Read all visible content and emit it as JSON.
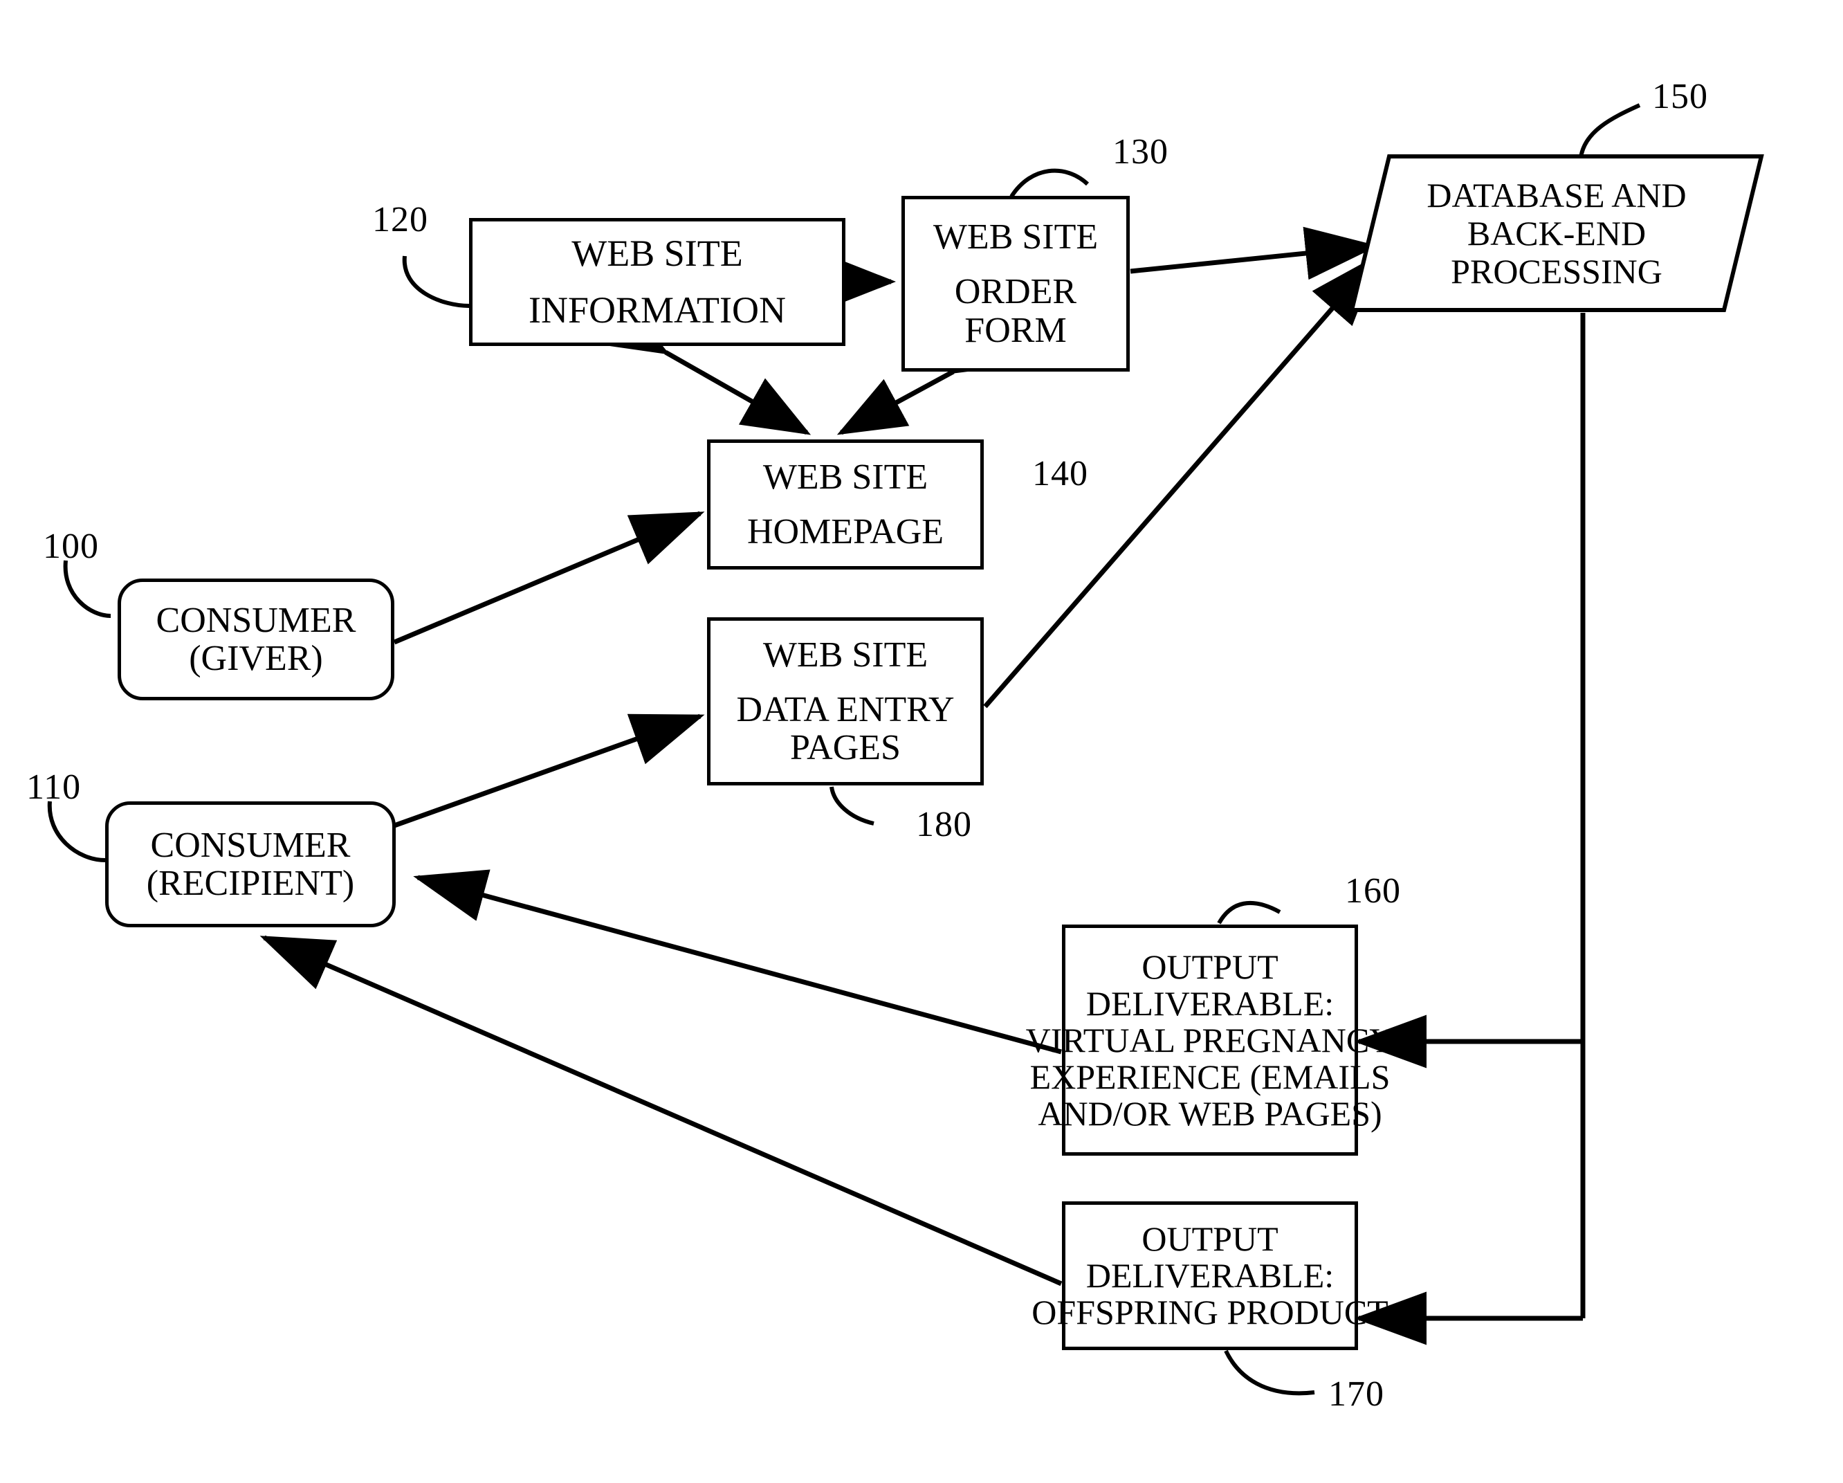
{
  "figure": {
    "type": "patent-flow-diagram",
    "background": "#ffffff",
    "stroke": "#000000"
  },
  "nodes": {
    "consumer_giver": {
      "ref": "100",
      "line1": "CONSUMER",
      "line2": "(GIVER)",
      "shape": "rounded-rectangle"
    },
    "consumer_recipient": {
      "ref": "110",
      "line1": "CONSUMER",
      "line2": "(RECIPIENT)",
      "shape": "rounded-rectangle"
    },
    "web_site_information": {
      "ref": "120",
      "line1": "WEB SITE",
      "line2": "INFORMATION",
      "shape": "rectangle"
    },
    "web_site_order_form": {
      "ref": "130",
      "line1": "WEB SITE",
      "line2": "ORDER",
      "line3": "FORM",
      "shape": "rectangle"
    },
    "web_site_homepage": {
      "ref": "140",
      "line1": "WEB SITE",
      "line2": "HOMEPAGE",
      "shape": "rectangle"
    },
    "database_backend": {
      "ref": "150",
      "line1": "DATABASE AND",
      "line2": "BACK-END",
      "line3": "PROCESSING",
      "shape": "parallelogram"
    },
    "output_virtual_pregnancy": {
      "ref": "160",
      "line1": "OUTPUT",
      "line2": "DELIVERABLE:",
      "line3": "VIRTUAL PREGNANCY",
      "line4": "EXPERIENCE (EMAILS",
      "line5": "AND/OR WEB PAGES)",
      "shape": "rectangle"
    },
    "output_offspring_product": {
      "ref": "170",
      "line1": "OUTPUT",
      "line2": "DELIVERABLE:",
      "line3": "OFFSPRING PRODUCT",
      "shape": "rectangle"
    },
    "web_site_data_entry_pages": {
      "ref": "180",
      "line1": "WEB SITE",
      "line2": "DATA ENTRY",
      "line3": "PAGES",
      "shape": "rectangle"
    }
  },
  "connections": [
    {
      "from": "web_site_information",
      "to": "web_site_order_form",
      "kind": "double-arrow"
    },
    {
      "from": "web_site_information",
      "to": "web_site_homepage",
      "kind": "double-arrow"
    },
    {
      "from": "web_site_order_form",
      "to": "web_site_homepage",
      "kind": "double-arrow"
    },
    {
      "from": "web_site_order_form",
      "to": "database_backend",
      "kind": "arrow"
    },
    {
      "from": "consumer_giver",
      "to": "web_site_homepage",
      "kind": "arrow"
    },
    {
      "from": "consumer_recipient",
      "to": "web_site_data_entry_pages",
      "kind": "arrow"
    },
    {
      "from": "web_site_data_entry_pages",
      "to": "database_backend",
      "kind": "arrow"
    },
    {
      "from": "database_backend",
      "to": "output_virtual_pregnancy",
      "kind": "arrow"
    },
    {
      "from": "database_backend",
      "to": "output_offspring_product",
      "kind": "arrow"
    },
    {
      "from": "output_virtual_pregnancy",
      "to": "consumer_recipient",
      "kind": "arrow"
    },
    {
      "from": "output_offspring_product",
      "to": "consumer_recipient",
      "kind": "arrow"
    }
  ]
}
